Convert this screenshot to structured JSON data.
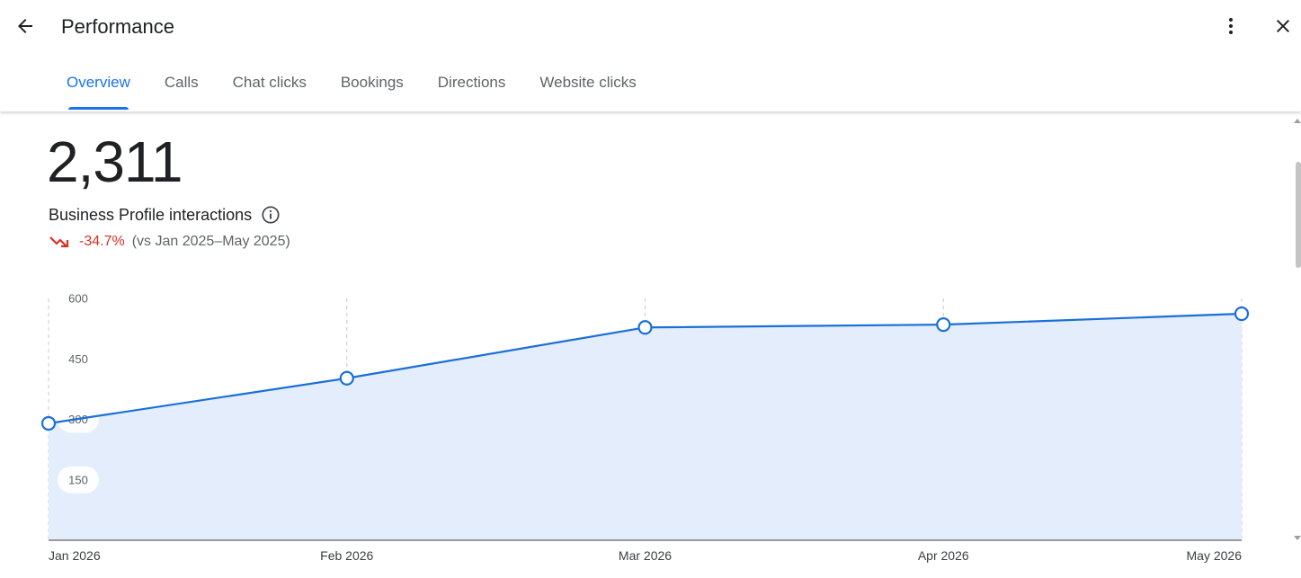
{
  "header": {
    "title": "Performance",
    "back_icon": "arrow-back-icon",
    "more_icon": "more-vert-icon",
    "close_icon": "close-icon"
  },
  "tabs": [
    {
      "label": "Overview",
      "active": true
    },
    {
      "label": "Calls",
      "active": false
    },
    {
      "label": "Chat clicks",
      "active": false
    },
    {
      "label": "Bookings",
      "active": false
    },
    {
      "label": "Directions",
      "active": false
    },
    {
      "label": "Website clicks",
      "active": false
    }
  ],
  "summary": {
    "total": "2,311",
    "label": "Business Profile interactions",
    "info_icon": "info-icon",
    "trend_icon": "trending-down-icon",
    "change": "-34.7%",
    "comparison": "(vs Jan 2025–May 2025)"
  },
  "colors": {
    "accent": "#1a73e8",
    "line": "#1a6fd8",
    "area_fill": "#e3edfc",
    "negative": "#d93025",
    "text_primary": "#202124",
    "text_secondary": "#5f6368"
  },
  "chart_data": {
    "type": "area",
    "categories": [
      "Jan 2026",
      "Feb 2026",
      "Mar 2026",
      "Apr 2026",
      "May 2026"
    ],
    "values": [
      290,
      402,
      528,
      535,
      562
    ],
    "yticks": [
      600,
      450,
      300,
      150
    ],
    "ylim": [
      0,
      600
    ],
    "grid": "vertical dashed",
    "legend": "none"
  }
}
